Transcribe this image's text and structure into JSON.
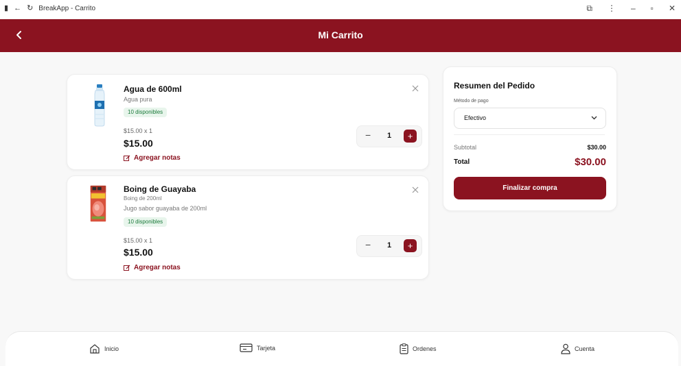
{
  "window": {
    "title": "BreakApp - Carrito"
  },
  "header": {
    "title": "Mi Carrito"
  },
  "items": [
    {
      "name": "Agua de 600ml",
      "subtitle": "Agua pura",
      "description": "",
      "availability": "10 disponibles",
      "unit_line": "$15.00 x 1",
      "total": "$15.00",
      "notes_label": "Agregar notas",
      "quantity": "1"
    },
    {
      "name": "Boing de Guayaba",
      "subtitle": "Boing de 200ml",
      "description": "Jugo sabor guayaba de 200ml",
      "availability": "10 disponibles",
      "unit_line": "$15.00 x 1",
      "total": "$15.00",
      "notes_label": "Agregar notas",
      "quantity": "1"
    }
  ],
  "summary": {
    "title": "Resumen del Pedido",
    "payment_label": "Método de pago",
    "payment_value": "Efectivo",
    "subtotal_label": "Subtotal",
    "subtotal_value": "$30.00",
    "total_label": "Total",
    "total_value": "$30.00",
    "checkout_label": "Finalizar compra"
  },
  "nav": {
    "home": "Inicio",
    "card": "Tarjeta",
    "orders": "Ordenes",
    "account": "Cuenta"
  },
  "colors": {
    "brand": "#8b1320",
    "badge_bg": "#e8f5ec",
    "badge_text": "#1a7a3a"
  },
  "icons": {
    "back": "chevron-left-icon",
    "close": "close-icon",
    "notes": "edit-icon",
    "home": "home-icon",
    "card": "card-icon",
    "orders": "clipboard-icon",
    "account": "user-icon"
  }
}
